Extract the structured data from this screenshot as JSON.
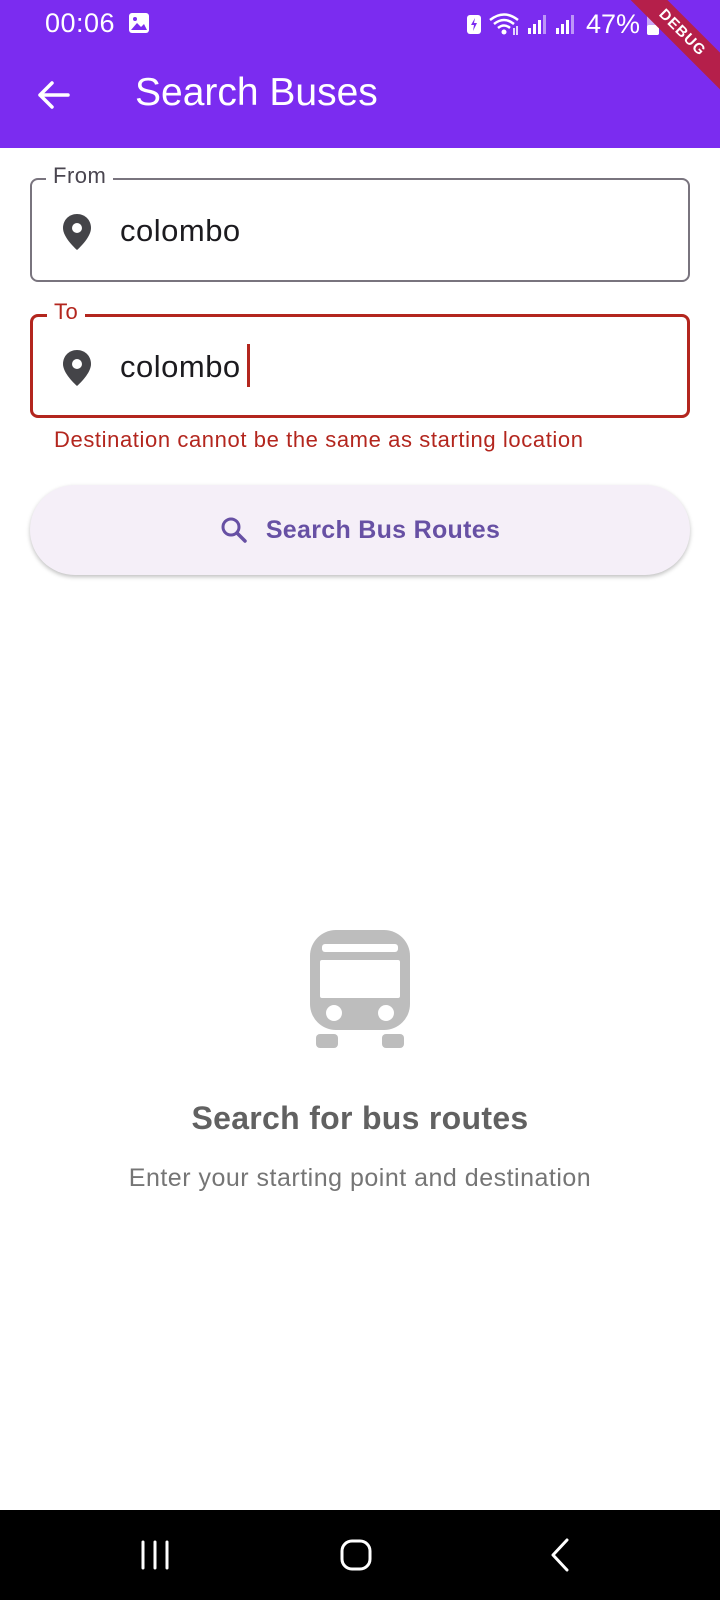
{
  "status_bar": {
    "time": "00:06",
    "battery_percent": "47%",
    "icons": [
      "gallery-icon",
      "battery-saver-icon",
      "wifi-icon",
      "signal-icon",
      "signal-icon",
      "battery-icon"
    ]
  },
  "debug_banner": "DEBUG",
  "app_bar": {
    "title": "Search Buses",
    "back_icon": "arrow-back-icon",
    "color": "#7b2cf0"
  },
  "form": {
    "from": {
      "label": "From",
      "value": "colombo",
      "icon": "location-pin-icon"
    },
    "to": {
      "label": "To",
      "value": "colombo",
      "icon": "location-pin-icon",
      "error": "Destination cannot be the same as starting location"
    },
    "error_color": "#b3261e"
  },
  "search_button": {
    "label": "Search Bus Routes",
    "icon": "search-icon",
    "color": "#6750a4"
  },
  "empty_state": {
    "icon": "bus-icon",
    "title": "Search for bus routes",
    "subtitle": "Enter your starting point and destination"
  },
  "nav_bar": {
    "buttons": [
      "recents-icon",
      "home-icon",
      "back-icon"
    ]
  }
}
